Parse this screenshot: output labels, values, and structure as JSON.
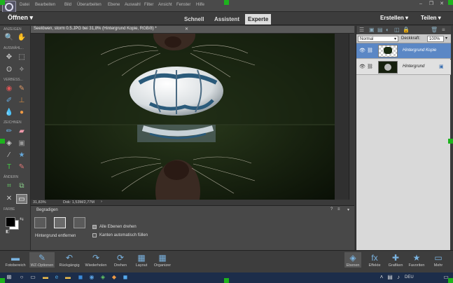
{
  "menubar": {
    "items": [
      "Datei",
      "Bearbeiten",
      "Bild",
      "Überarbeiten",
      "Ebene",
      "Auswahl",
      "Filter",
      "Ansicht",
      "Fenster",
      "Hilfe"
    ],
    "window_controls": [
      "–",
      "❐",
      "✕"
    ]
  },
  "modebar": {
    "open_label": "Öffnen",
    "tabs": [
      {
        "label": "Schnell"
      },
      {
        "label": "Assistent"
      },
      {
        "label": "Experte"
      }
    ],
    "create_label": "Erstellen",
    "share_label": "Teilen"
  },
  "toolbox": {
    "sections": [
      "ANZEIGEN",
      "AUSWÄHL...",
      "VERBESS...",
      "ZEICHNEN",
      "ÄNDERN",
      "FARBE"
    ]
  },
  "document": {
    "tab_title": "Seelöwen, storm 0.5.JPG bei 31,8% (Hintergrund Kopie, RGB/8) *",
    "zoom": "31,83%",
    "doc_size": "Dok: 1,53M/2,77M"
  },
  "options": {
    "title": "Begradigen",
    "mode_label": "Hintergrund entfernen",
    "checkbox_all_layers": "Alle Ebenen drehen",
    "checkbox_auto_fill": "Kanten automatisch füllen"
  },
  "layers": {
    "blend_mode": "Normal",
    "opacity_label": "Deckkraft:",
    "opacity_value": "100%",
    "items": [
      {
        "name": "Hintergrund Kopie",
        "selected": true
      },
      {
        "name": "Hintergrund",
        "selected": false
      }
    ]
  },
  "bottombar": {
    "left": [
      "Fotobereich",
      "WZ-Optionen",
      "Rückgängig",
      "Wiederholen",
      "Drehen",
      "Layout",
      "Organizer"
    ],
    "right": [
      "Ebenen",
      "Effekte",
      "Grafiken",
      "Favoriten",
      "Mehr"
    ]
  },
  "taskbar": {
    "language": "DEU"
  },
  "colors": {
    "accent": "#7ab3e0",
    "selected_layer": "#5b87c5",
    "handle": "#1db31d"
  }
}
